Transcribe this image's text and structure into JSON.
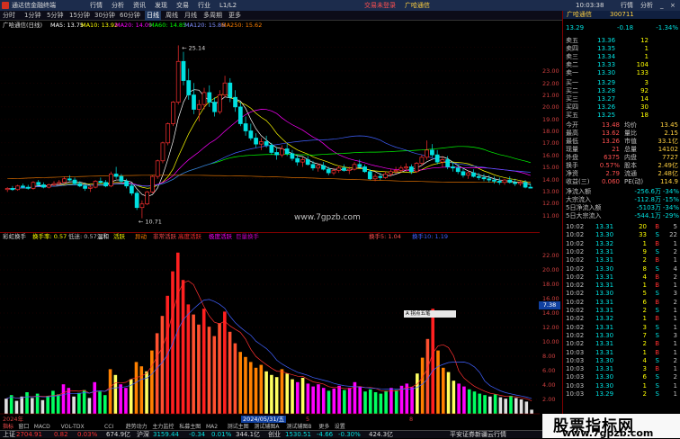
{
  "titlebar": {
    "app_name": "通达信金融终端",
    "menus": [
      "行情",
      "分析",
      "资讯",
      "发现",
      "交易",
      "行业",
      "L1/L2"
    ],
    "trade_text": "交易未登录",
    "broker_text": "广哈通信",
    "time": "10:03:38",
    "right_menus": [
      "行情",
      "分析"
    ]
  },
  "toolbar": {
    "items": [
      "分时",
      "1分钟",
      "5分钟",
      "15分钟",
      "30分钟",
      "60分钟",
      "日线",
      "周线",
      "月线",
      "多周期",
      "更多"
    ],
    "active": "日线"
  },
  "chart_info": {
    "name": "广哈通信(日线)",
    "ma5": "MA5: 13.75",
    "ma10": "MA10: 13.92",
    "ma20": "MA20: 14.09",
    "ma60": "MA60: 14.85",
    "ma120": "MA120: 15.86",
    "ma250": "MA250: 15.62"
  },
  "main_chart": {
    "high_label": "25.14",
    "low_label": "10.71",
    "watermark": "www.7gpzb.com",
    "axis": [
      "23.00",
      "22.00",
      "21.00",
      "20.00",
      "19.00",
      "18.00",
      "17.00",
      "16.00",
      "15.00",
      "14.00",
      "13.00",
      "12.00",
      "11.00"
    ]
  },
  "sub_info": {
    "name": "彩虹换手",
    "label1": "换手率: 0.57",
    "label2": "低迷: 0.57",
    "legend": [
      "温和",
      "活跃",
      "异动",
      "非常活跃",
      "高度活跃",
      "极度活跃",
      "巨量换手"
    ],
    "right1": "换手5: 1.04",
    "right2": "换手10: 1.19"
  },
  "sub_chart": {
    "axis": [
      "22.00",
      "20.00",
      "18.00",
      "16.00",
      "14.00",
      "12.00",
      "10.00",
      "8.00",
      "6.00",
      "4.00",
      "2.00"
    ],
    "cursor_value": "7.38",
    "tooltip": "A 拐点五笔"
  },
  "date_bar": {
    "start": "2024年",
    "cursor_date": "2024/05/31/五",
    "mid1": "5",
    "mid2": "8"
  },
  "bottom_tabs": [
    "指标",
    "窗口",
    "MACD",
    "VOL-TDX",
    "CCI",
    "趋势动力",
    "主力监控",
    "私募主图",
    "MA2",
    "测试主图",
    "测试辅图A",
    "测试辅图B",
    "更多",
    "设置"
  ],
  "bottom_tabs2": [
    "日K线",
    "关联板块",
    "资金分布",
    "综合资讯",
    "行业资讯",
    "互动问答",
    "首页推荐",
    "操盘回顾"
  ],
  "quote": {
    "name": "广哈通信",
    "code": "300711",
    "price": "13.29",
    "change": "-0.18",
    "pct": "-1.34%",
    "sells": [
      {
        "label": "卖五",
        "price": "13.36",
        "vol": "12"
      },
      {
        "label": "卖四",
        "price": "13.35",
        "vol": "1"
      },
      {
        "label": "卖三",
        "price": "13.34",
        "vol": "1"
      },
      {
        "label": "卖二",
        "price": "13.33",
        "vol": "104"
      },
      {
        "label": "卖一",
        "price": "13.30",
        "vol": "133"
      }
    ],
    "buys": [
      {
        "label": "买一",
        "price": "13.29",
        "vol": "3"
      },
      {
        "label": "买二",
        "price": "13.28",
        "vol": "92"
      },
      {
        "label": "买三",
        "price": "13.27",
        "vol": "14"
      },
      {
        "label": "买四",
        "price": "13.26",
        "vol": "30"
      },
      {
        "label": "买五",
        "price": "13.25",
        "vol": "18"
      }
    ],
    "stats": [
      {
        "l1": "今开",
        "v1": "13.48",
        "l2": "均价",
        "v2": "13.45"
      },
      {
        "l1": "最高",
        "v1": "13.62",
        "l2": "量比",
        "v2": "2.15"
      },
      {
        "l1": "最低",
        "v1": "13.26",
        "l2": "市值",
        "v2": "33.1亿"
      },
      {
        "l1": "现量",
        "v1": "21",
        "l2": "总量",
        "v2": "14102"
      },
      {
        "l1": "外盘",
        "v1": "6375",
        "l2": "内盘",
        "v2": "7727"
      },
      {
        "l1": "换手",
        "v1": "0.57%",
        "l2": "股本",
        "v2": "2.49亿"
      },
      {
        "l1": "净资",
        "v1": "2.79",
        "l2": "流通",
        "v2": "2.48亿"
      },
      {
        "l1": "收益(三)",
        "v1": "0.060",
        "l2": "PE(动)",
        "v2": "114.9"
      }
    ],
    "flows": [
      {
        "l": "净流入额",
        "v": "-256.6万",
        "p": "-34%"
      },
      {
        "l": "大宗流入",
        "v": "-112.8万",
        "p": "-15%"
      },
      {
        "l": "5日净流入额",
        "v": "-5103万",
        "p": "-34%"
      },
      {
        "l": "5日大宗流入",
        "v": "-544.1万",
        "p": "-29%"
      }
    ],
    "ticks": [
      {
        "t": "10:02",
        "p": "13.31",
        "v": "20",
        "d": "B",
        "n": "5"
      },
      {
        "t": "10:02",
        "p": "13.30",
        "v": "33",
        "d": "S",
        "n": "22"
      },
      {
        "t": "10:02",
        "p": "13.32",
        "v": "1",
        "d": "B",
        "n": "1"
      },
      {
        "t": "10:02",
        "p": "13.31",
        "v": "9",
        "d": "S",
        "n": "2"
      },
      {
        "t": "10:02",
        "p": "13.31",
        "v": "2",
        "d": "B",
        "n": "1"
      },
      {
        "t": "10:02",
        "p": "13.30",
        "v": "8",
        "d": "S",
        "n": "4"
      },
      {
        "t": "10:02",
        "p": "13.31",
        "v": "4",
        "d": "B",
        "n": "2"
      },
      {
        "t": "10:02",
        "p": "13.31",
        "v": "1",
        "d": "B",
        "n": "1"
      },
      {
        "t": "10:02",
        "p": "13.30",
        "v": "5",
        "d": "S",
        "n": "3"
      },
      {
        "t": "10:02",
        "p": "13.31",
        "v": "6",
        "d": "B",
        "n": "2"
      },
      {
        "t": "10:02",
        "p": "13.31",
        "v": "2",
        "d": "S",
        "n": "1"
      },
      {
        "t": "10:02",
        "p": "13.32",
        "v": "1",
        "d": "B",
        "n": "1"
      },
      {
        "t": "10:02",
        "p": "13.31",
        "v": "3",
        "d": "S",
        "n": "1"
      },
      {
        "t": "10:02",
        "p": "13.30",
        "v": "7",
        "d": "S",
        "n": "3"
      },
      {
        "t": "10:02",
        "p": "13.31",
        "v": "2",
        "d": "B",
        "n": "1"
      },
      {
        "t": "10:03",
        "p": "13.31",
        "v": "1",
        "d": "B",
        "n": "1"
      },
      {
        "t": "10:03",
        "p": "13.30",
        "v": "4",
        "d": "S",
        "n": "2"
      },
      {
        "t": "10:03",
        "p": "13.31",
        "v": "3",
        "d": "B",
        "n": "1"
      },
      {
        "t": "10:03",
        "p": "13.30",
        "v": "6",
        "d": "S",
        "n": "2"
      },
      {
        "t": "10:03",
        "p": "13.30",
        "v": "1",
        "d": "S",
        "n": "1"
      },
      {
        "t": "10:03",
        "p": "13.29",
        "v": "2",
        "d": "S",
        "n": "1"
      }
    ]
  },
  "bottombar": {
    "sh_label": "上证",
    "sh_value": "2704.91",
    "sh_chg": "0.82",
    "sh_pct": "0.03%",
    "sh_amt": "674.9亿",
    "hs_label": "沪深",
    "hs_value": "3159.44",
    "hs_chg": "-0.34",
    "hs_pct": "0.01%",
    "hs_amt": "344.1亿",
    "cy_label": "创业",
    "cy_value": "1530.51",
    "cy_chg": "-4.66",
    "cy_pct": "-0.30%",
    "cy_amt": "424.3亿",
    "broker": "平安证券新疆云行情"
  },
  "watermark_box": {
    "line1": "股票指标网",
    "line2": "www.7gpzb.com"
  },
  "colors": {
    "up": "#ff3030",
    "down": "#00e0e0",
    "ma5": "#ffffff",
    "ma10": "#ffff00",
    "ma20": "#ff00ff",
    "ma60": "#00ff00",
    "ma120": "#4060ff",
    "ma250": "#ff8000"
  },
  "chart_data": {
    "type": "candlestick",
    "ylim": [
      10,
      26
    ],
    "candles": [
      [
        13.1,
        13.3,
        12.9,
        13.2
      ],
      [
        13.2,
        13.4,
        13.0,
        13.1
      ],
      [
        13.1,
        13.5,
        13.0,
        13.4
      ],
      [
        13.4,
        13.6,
        13.2,
        13.3
      ],
      [
        13.3,
        13.5,
        13.1,
        13.2
      ],
      [
        13.2,
        13.8,
        13.1,
        13.7
      ],
      [
        13.7,
        13.9,
        13.4,
        13.5
      ],
      [
        13.5,
        13.7,
        13.2,
        13.3
      ],
      [
        13.3,
        13.6,
        13.2,
        13.5
      ],
      [
        13.5,
        13.8,
        13.4,
        13.6
      ],
      [
        13.6,
        13.9,
        13.5,
        13.7
      ],
      [
        13.7,
        14.2,
        13.6,
        14.0
      ],
      [
        14.0,
        14.3,
        13.8,
        13.9
      ],
      [
        13.9,
        14.1,
        13.5,
        13.6
      ],
      [
        13.6,
        13.8,
        13.3,
        13.4
      ],
      [
        13.4,
        13.6,
        13.0,
        13.2
      ],
      [
        13.2,
        13.5,
        12.9,
        13.3
      ],
      [
        13.3,
        13.9,
        13.2,
        13.8
      ],
      [
        13.8,
        14.1,
        13.6,
        13.7
      ],
      [
        13.7,
        13.9,
        13.3,
        13.4
      ],
      [
        13.4,
        14.6,
        13.3,
        14.4
      ],
      [
        14.4,
        15.0,
        14.0,
        14.2
      ],
      [
        14.2,
        14.4,
        13.6,
        13.8
      ],
      [
        13.8,
        14.0,
        13.2,
        13.4
      ],
      [
        13.4,
        13.6,
        12.6,
        12.8
      ],
      [
        12.8,
        13.0,
        11.4,
        11.6
      ],
      [
        11.6,
        12.2,
        10.71,
        11.9
      ],
      [
        11.9,
        13.0,
        11.8,
        12.9
      ],
      [
        12.9,
        14.3,
        12.8,
        14.2
      ],
      [
        14.2,
        15.6,
        14.0,
        15.5
      ],
      [
        15.5,
        17.1,
        15.3,
        17.0
      ],
      [
        17.0,
        18.7,
        16.8,
        18.6
      ],
      [
        18.6,
        20.5,
        18.4,
        20.4
      ],
      [
        20.4,
        25.14,
        20.2,
        23.8
      ],
      [
        23.8,
        24.6,
        21.8,
        22.2
      ],
      [
        22.2,
        23.2,
        20.6,
        21.0
      ],
      [
        21.0,
        22.0,
        19.4,
        19.8
      ],
      [
        19.8,
        20.6,
        18.8,
        20.2
      ],
      [
        20.2,
        21.6,
        19.8,
        21.2
      ],
      [
        21.2,
        21.8,
        20.0,
        20.4
      ],
      [
        20.4,
        20.8,
        19.2,
        19.6
      ],
      [
        19.6,
        21.4,
        19.4,
        21.0
      ],
      [
        21.0,
        22.6,
        20.8,
        22.0
      ],
      [
        22.0,
        22.4,
        20.4,
        20.8
      ],
      [
        20.8,
        21.4,
        19.6,
        20.0
      ],
      [
        20.0,
        20.4,
        18.4,
        18.6
      ],
      [
        18.6,
        19.2,
        17.6,
        18.0
      ],
      [
        18.0,
        18.6,
        17.2,
        17.4
      ],
      [
        17.4,
        17.8,
        16.6,
        16.9
      ],
      [
        16.9,
        17.4,
        16.4,
        17.1
      ],
      [
        17.1,
        17.6,
        16.6,
        16.8
      ],
      [
        16.8,
        17.0,
        16.0,
        16.2
      ],
      [
        16.2,
        16.6,
        15.6,
        16.0
      ],
      [
        16.0,
        16.8,
        15.8,
        16.5
      ],
      [
        16.5,
        16.9,
        15.9,
        16.1
      ],
      [
        16.1,
        16.4,
        15.5,
        15.7
      ],
      [
        15.7,
        16.0,
        15.1,
        15.4
      ],
      [
        15.4,
        15.8,
        15.0,
        15.6
      ],
      [
        15.6,
        15.9,
        15.1,
        15.2
      ],
      [
        15.2,
        15.5,
        14.7,
        14.9
      ],
      [
        14.9,
        15.3,
        14.6,
        15.1
      ],
      [
        15.1,
        15.4,
        14.7,
        14.8
      ],
      [
        14.8,
        15.0,
        14.3,
        14.5
      ],
      [
        14.5,
        14.9,
        14.3,
        14.7
      ],
      [
        14.7,
        15.1,
        14.5,
        14.9
      ],
      [
        14.9,
        15.2,
        14.6,
        14.7
      ],
      [
        14.7,
        15.0,
        14.4,
        14.8
      ],
      [
        14.8,
        15.4,
        14.7,
        15.2
      ],
      [
        15.2,
        15.6,
        14.9,
        15.0
      ],
      [
        15.0,
        15.2,
        14.5,
        14.6
      ],
      [
        14.6,
        14.8,
        13.9,
        14.0
      ],
      [
        14.0,
        14.4,
        13.8,
        14.2
      ],
      [
        14.2,
        14.5,
        13.9,
        14.1
      ],
      [
        14.1,
        14.6,
        14.0,
        14.4
      ],
      [
        14.4,
        14.8,
        14.2,
        14.6
      ],
      [
        14.6,
        15.0,
        14.4,
        14.7
      ],
      [
        14.7,
        15.1,
        14.5,
        14.9
      ],
      [
        14.9,
        15.3,
        14.6,
        15.0
      ],
      [
        15.0,
        15.2,
        14.4,
        14.6
      ],
      [
        14.6,
        15.4,
        14.5,
        15.3
      ],
      [
        15.3,
        16.0,
        15.1,
        15.8
      ],
      [
        15.8,
        17.2,
        15.6,
        16.4
      ],
      [
        16.4,
        16.9,
        15.8,
        16.0
      ],
      [
        16.0,
        16.4,
        15.2,
        15.4
      ],
      [
        15.4,
        15.9,
        15.0,
        15.6
      ],
      [
        15.6,
        15.9,
        14.8,
        15.0
      ],
      [
        15.0,
        15.4,
        14.6,
        14.9
      ],
      [
        14.9,
        15.2,
        14.4,
        14.6
      ],
      [
        14.6,
        14.9,
        14.1,
        14.3
      ],
      [
        14.3,
        14.7,
        14.0,
        14.5
      ],
      [
        14.5,
        14.8,
        14.1,
        14.2
      ],
      [
        14.2,
        14.5,
        13.9,
        14.1
      ],
      [
        14.1,
        14.4,
        13.8,
        14.0
      ],
      [
        14.0,
        14.3,
        13.7,
        13.9
      ],
      [
        13.9,
        14.2,
        13.6,
        13.8
      ],
      [
        13.8,
        14.1,
        13.5,
        13.7
      ],
      [
        13.7,
        14.0,
        13.5,
        13.9
      ],
      [
        13.9,
        14.2,
        13.6,
        13.7
      ],
      [
        13.7,
        14.0,
        13.4,
        13.6
      ],
      [
        13.6,
        13.9,
        13.4,
        13.7
      ],
      [
        13.7,
        13.9,
        13.2,
        13.3
      ],
      [
        13.3,
        13.6,
        13.2,
        13.29
      ]
    ],
    "turnover": [
      2.1,
      2.6,
      1.8,
      2.4,
      3.0,
      2.2,
      2.8,
      1.9,
      2.5,
      3.2,
      2.7,
      4.1,
      3.6,
      2.4,
      2.9,
      3.3,
      2.2,
      4.4,
      3.1,
      2.6,
      6.2,
      5.4,
      4.1,
      3.6,
      4.8,
      7.2,
      6.6,
      5.9,
      8.8,
      11.2,
      13.6,
      16.4,
      19.8,
      22.4,
      18.6,
      15.2,
      13.8,
      12.4,
      14.6,
      12.1,
      10.8,
      12.6,
      14.2,
      11.4,
      9.8,
      8.6,
      7.9,
      7.2,
      6.4,
      6.8,
      5.9,
      5.4,
      5.1,
      6.2,
      5.6,
      4.8,
      4.4,
      5.0,
      4.2,
      3.8,
      4.1,
      3.6,
      3.2,
      3.5,
      3.9,
      3.3,
      3.6,
      4.4,
      3.8,
      3.1,
      3.4,
      3.0,
      2.8,
      3.2,
      3.6,
      3.3,
      3.9,
      4.2,
      3.7,
      5.6,
      7.8,
      10.4,
      14.6,
      8.8,
      6.4,
      5.8,
      4.6,
      4.2,
      3.8,
      3.4,
      3.1,
      2.8,
      2.6,
      2.4,
      2.7,
      2.3,
      2.1,
      2.5,
      2.2,
      2.0,
      1.7,
      0.57
    ]
  }
}
